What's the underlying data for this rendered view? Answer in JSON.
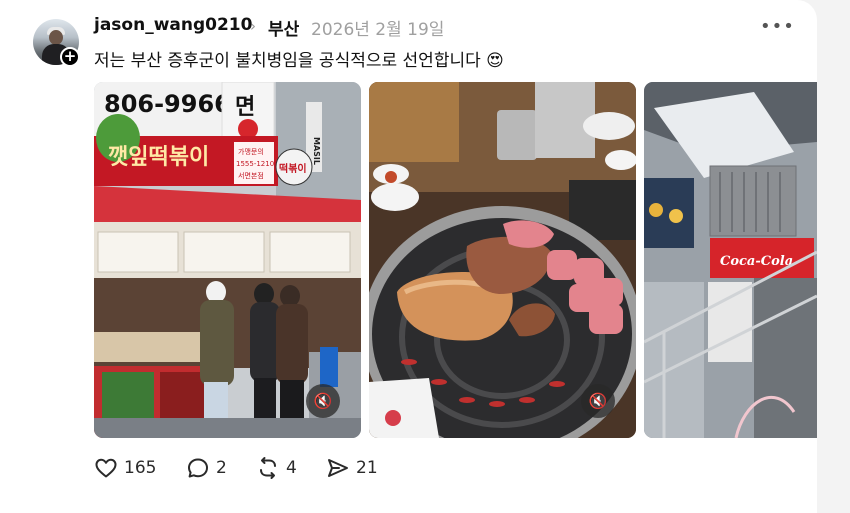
{
  "post": {
    "username": "jason_wang0210",
    "location": "부산",
    "date": "2026년 2월 19일",
    "caption": "저는 부산 증후군이 불치병임을 공식적으로 선언합니다 😍",
    "follow_symbol": "+",
    "more_symbol": "•••"
  },
  "media": [
    {
      "kind": "video",
      "scene": "street-food-stall",
      "signs": {
        "phone": "806-9966",
        "shop_name": "깻잎떡볶이",
        "noodle_sign": "면",
        "small_sign_top": "가맹문의",
        "small_sign_phone": "1555-1210",
        "small_sign_bottom": "서면본점",
        "round_sign": "떡볶이",
        "vertical_sign": "MASIL"
      },
      "muted": true
    },
    {
      "kind": "video",
      "scene": "korean-bbq-grill",
      "muted": true
    },
    {
      "kind": "image",
      "scene": "restaurant-interior",
      "signs": {
        "brand": "Coca-Cola"
      }
    }
  ],
  "actions": {
    "likes": "165",
    "replies": "2",
    "reposts": "4",
    "shares": "21"
  },
  "colors": {
    "accent": "#000000",
    "muted_text": "#a0a0a0"
  }
}
